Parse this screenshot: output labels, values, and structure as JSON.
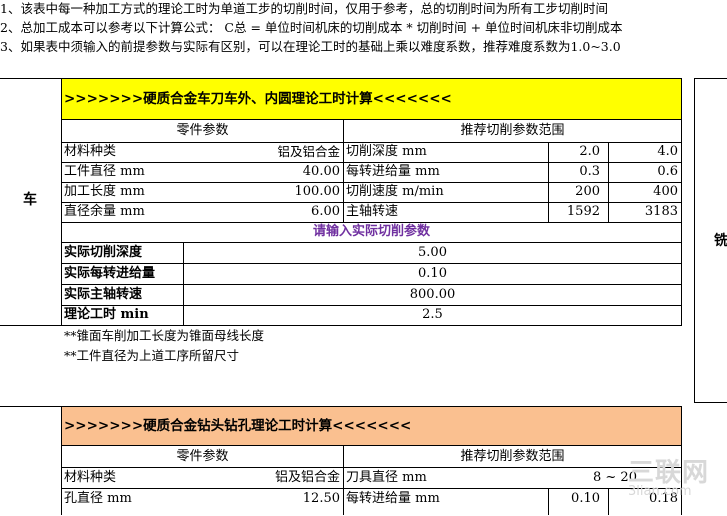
{
  "notes": [
    "1、该表中每一种加工方式的理论工时为单道工步的切削时间，仅用于参考，总的切削时间为所有工步切削时间",
    "2、总加工成本可以参考以下计算公式：   C总 = 单位时间机床的切削成本 * 切削时间 + 单位时间机床非切削成本",
    "3、如果表中须输入的前提参数与实际有区别，可以在理论工时的基础上乘以难度系数，推荐难度系数为1.0~3.0"
  ],
  "turning": {
    "side_label": "车",
    "title": ">>>>>>>硬质合金车刀车外、内圆理论工时计算<<<<<<<",
    "part_params_header": "零件参数",
    "cutting_params_header": "推荐切削参数范围",
    "rows": [
      {
        "label": "材料种类",
        "value": "铝及铝合金",
        "param": "切削深度 mm",
        "min": "2.0",
        "max": "4.0"
      },
      {
        "label": "工件直径 mm",
        "value": "40.00",
        "param": "每转进给量 mm",
        "min": "0.3",
        "max": "0.6"
      },
      {
        "label": "加工长度 mm",
        "value": "100.00",
        "param": "切削速度 m/min",
        "min": "200",
        "max": "400"
      },
      {
        "label": "直径余量 mm",
        "value": "6.00",
        "param": "主轴转速",
        "min": "1592",
        "max": "3183"
      }
    ],
    "input_prompt": "请输入实际切削参数",
    "actual": [
      {
        "label": "实际切削深度",
        "value": "5.00"
      },
      {
        "label": "实际每转进给量",
        "value": "0.10"
      },
      {
        "label": "实际主轴转速",
        "value": "800.00"
      },
      {
        "label": "理论工时 min",
        "value": "2.5"
      }
    ],
    "footnotes": [
      "**锥面车削加工长度为锥面母线长度",
      "**工件直径为上道工序所留尺寸"
    ]
  },
  "right_panel": {
    "side_label": "铣"
  },
  "drilling": {
    "title": ">>>>>>>硬质合金钻头钻孔理论工时计算<<<<<<<",
    "part_params_header": "零件参数",
    "cutting_params_header": "推荐切削参数范围",
    "rows": [
      {
        "label": "材料种类",
        "value": "铝及铝合金",
        "param": "刀具直径 mm",
        "range": "8 ~ 20"
      },
      {
        "label": "孔直径 mm",
        "value": "12.50",
        "param": "每转进给量 mm",
        "min": "0.10",
        "max": "0.18"
      }
    ]
  },
  "watermark": {
    "logo_text": "三联网",
    "url_text": "3lian.com"
  },
  "colors": {
    "turning_title_bg": "#ffff00",
    "drilling_title_bg": "#fac090",
    "input_prompt_color": "#7030a0"
  }
}
